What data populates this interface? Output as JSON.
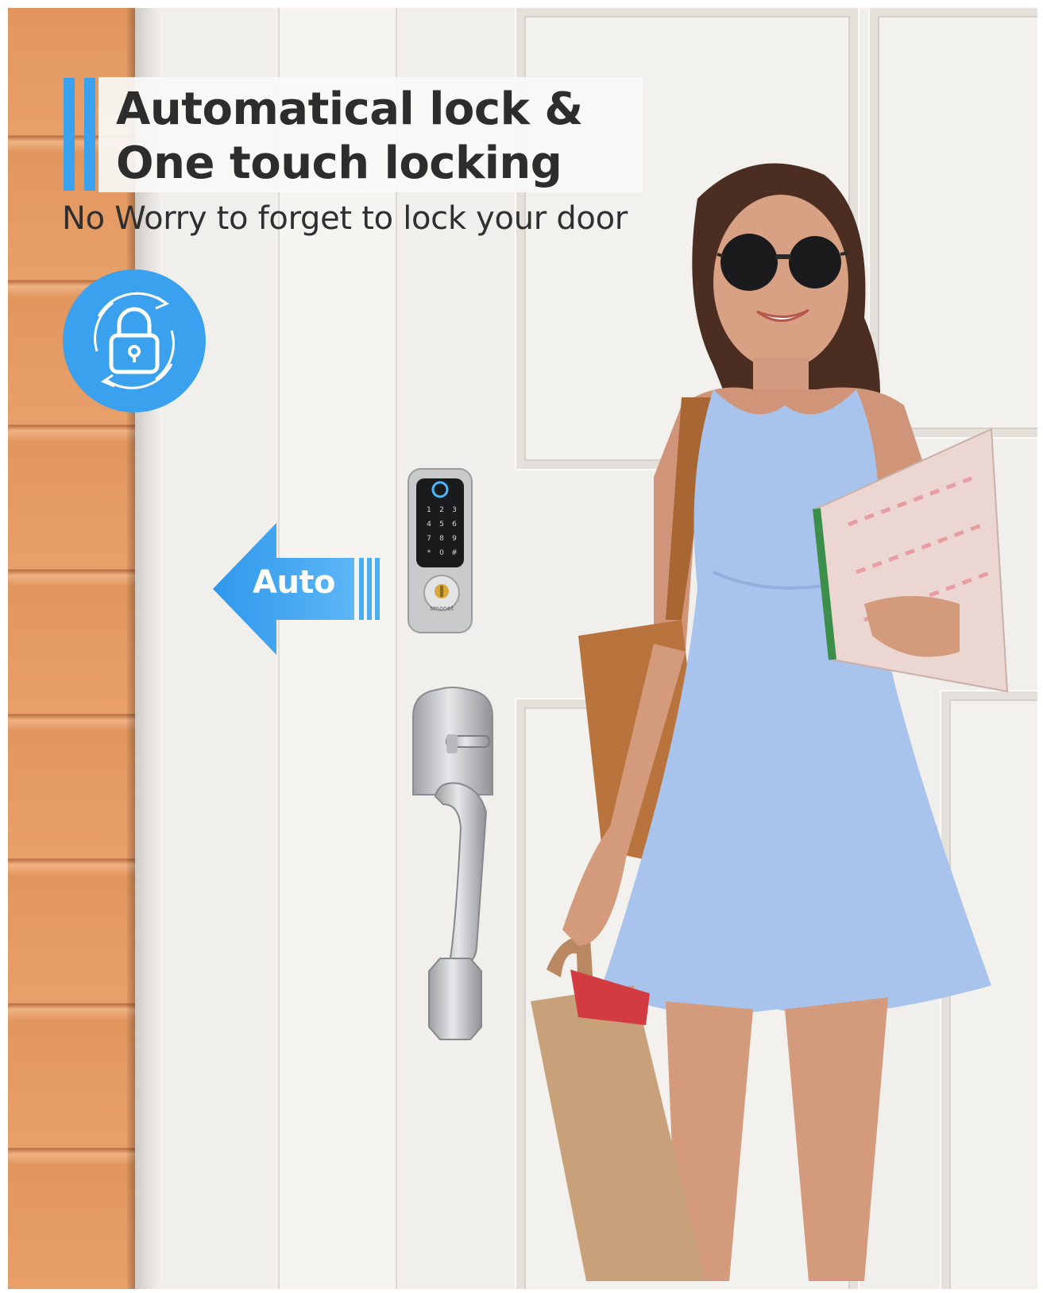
{
  "headline": {
    "line1": "Automatical lock &",
    "line2": "One touch locking"
  },
  "subtitle": "No Worry to forget to lock your door",
  "badge": {
    "icon": "auto-lock-icon"
  },
  "auto_arrow": {
    "label": "Auto"
  },
  "keypad": {
    "keys": [
      "1",
      "2",
      "3",
      "4",
      "5",
      "6",
      "7",
      "8",
      "9",
      "*",
      "0",
      "#"
    ],
    "brand": "smonet"
  },
  "colors": {
    "accent": "#3aa1ee",
    "siding": "#e2965e",
    "door": "#f1efec",
    "dress": "#a9c4ec",
    "bag": "#b9743d"
  }
}
